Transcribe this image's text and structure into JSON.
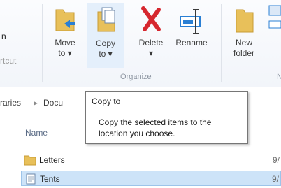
{
  "ribbon": {
    "left_fragment_top": "n",
    "left_fragment_bottom": "rtcut",
    "move_label": "Move\nto ▾",
    "copy_label": "Copy\nto ▾",
    "delete_label": "Delete\n▾",
    "rename_label": "Rename",
    "new_folder_label": "New\nfolder",
    "organize_label": "Organize",
    "right_group_fragment": "N"
  },
  "address": {
    "part1": "raries",
    "sep": "▸",
    "part2": "Docu"
  },
  "list": {
    "header_name": "Name",
    "rows": [
      {
        "name": "Letters",
        "date": "9/"
      },
      {
        "name": "Tents",
        "date": "9/"
      }
    ]
  },
  "tooltip": {
    "title": "Copy to",
    "body": "Copy the selected items to the location you choose."
  },
  "colors": {
    "folder": "#e8c05a",
    "selection": "#cde3f8",
    "delete_red": "#d6272f"
  }
}
